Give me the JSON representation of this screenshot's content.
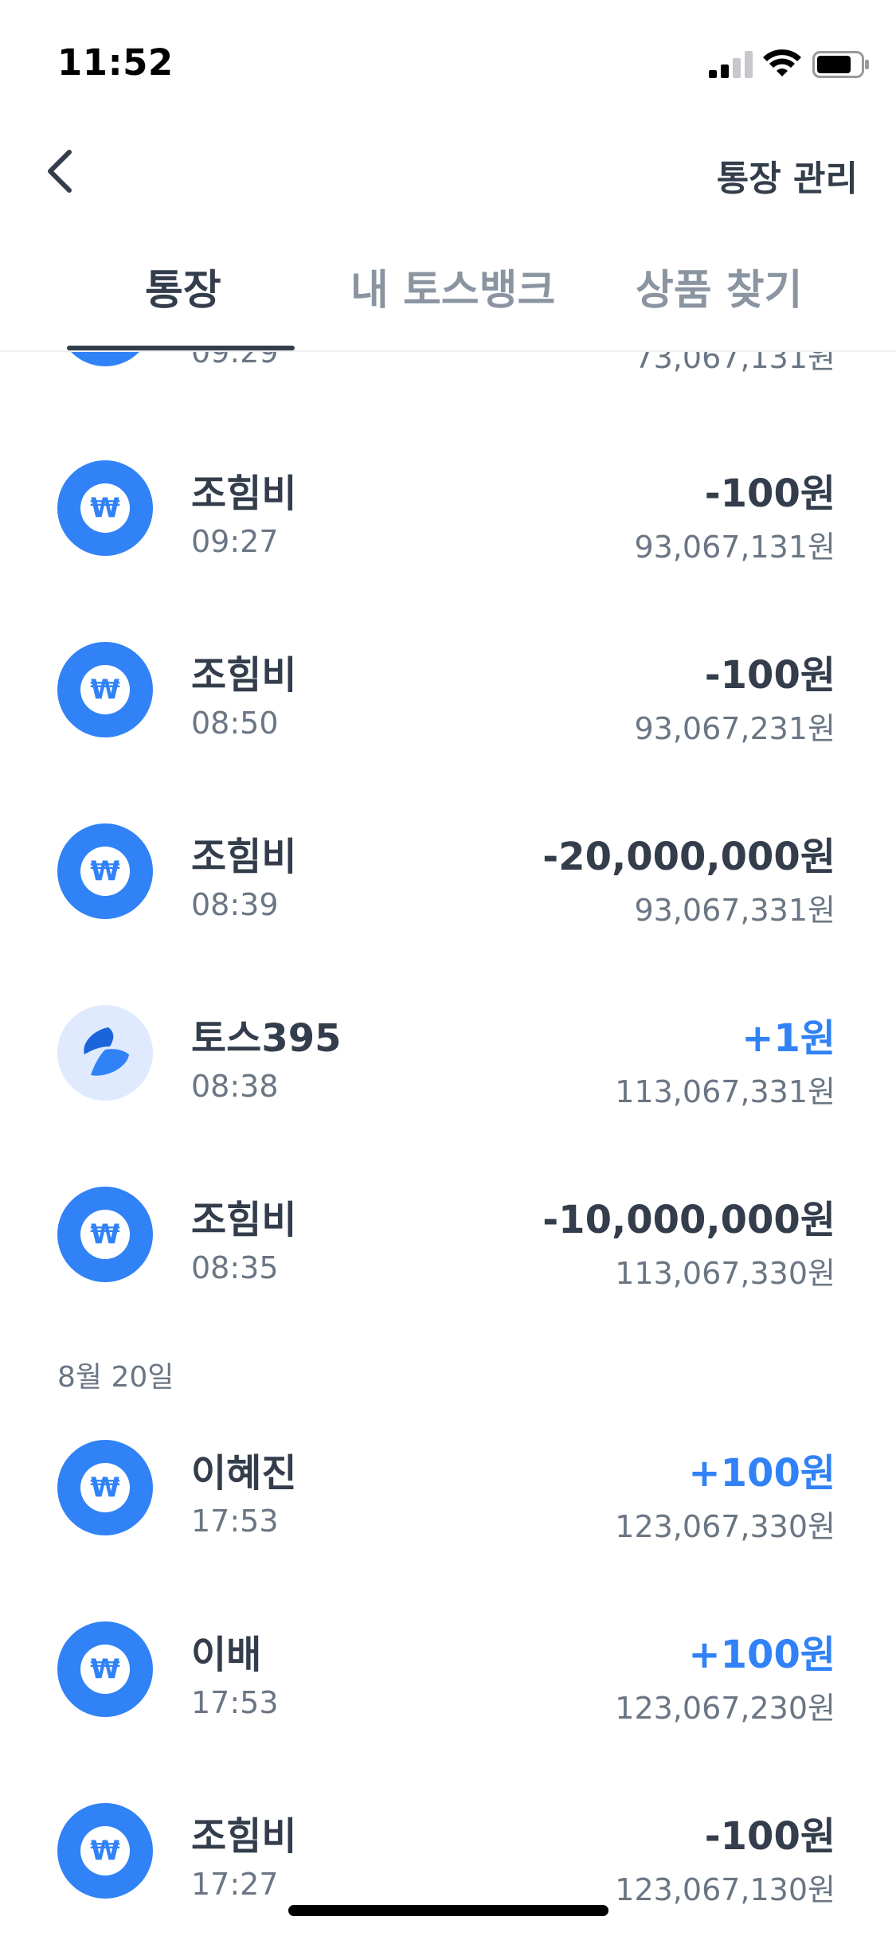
{
  "status_bar": {
    "time": "11:52"
  },
  "nav": {
    "manage_label": "통장 관리"
  },
  "tabs": [
    {
      "label": "통장",
      "active": true
    },
    {
      "label": "내 토스뱅크",
      "active": false
    },
    {
      "label": "상품 찾기",
      "active": false
    }
  ],
  "partial_row": {
    "time": "09:29",
    "balance": "73,067,131원"
  },
  "transactions": [
    {
      "name": "조힘비",
      "time": "09:27",
      "amount": "-100원",
      "balance": "93,067,131원",
      "icon": "won-icon"
    },
    {
      "name": "조힘비",
      "time": "08:50",
      "amount": "-100원",
      "balance": "93,067,231원",
      "icon": "won-icon"
    },
    {
      "name": "조힘비",
      "time": "08:39",
      "amount": "-20,000,000원",
      "balance": "93,067,331원",
      "icon": "won-icon"
    },
    {
      "name": "토스395",
      "time": "08:38",
      "amount": "+1원",
      "balance": "113,067,331원",
      "icon": "toss-logo-icon"
    },
    {
      "name": "조힘비",
      "time": "08:35",
      "amount": "-10,000,000원",
      "balance": "113,067,330원",
      "icon": "won-icon"
    }
  ],
  "date_header": "8월 20일",
  "transactions_aug20": [
    {
      "name": "이혜진",
      "time": "17:53",
      "amount": "+100원",
      "balance": "123,067,330원",
      "icon": "won-icon"
    },
    {
      "name": "이배",
      "time": "17:53",
      "amount": "+100원",
      "balance": "123,067,230원",
      "icon": "won-icon"
    },
    {
      "name": "조힘비",
      "time": "17:27",
      "amount": "-100원",
      "balance": "123,067,130원",
      "icon": "won-icon"
    }
  ],
  "colors": {
    "accent": "#3182f6",
    "text_primary": "#333d4b",
    "text_secondary": "#6b7684"
  }
}
